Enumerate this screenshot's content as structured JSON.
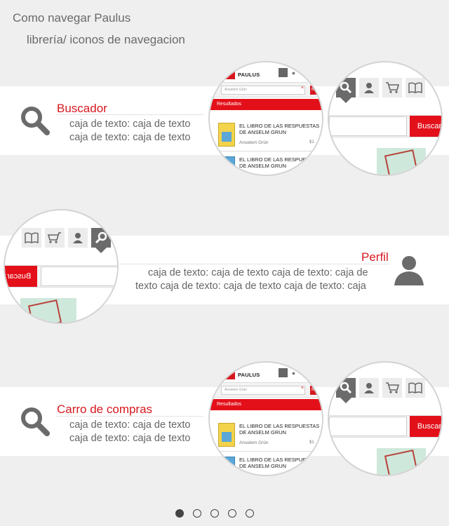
{
  "header": {
    "title": "Como navegar Paulus",
    "subtitle": "librería/ iconos de navegacion"
  },
  "sections": [
    {
      "title": "Buscador",
      "lines": [
        "caja de texto: caja de texto",
        "caja de texto: caja de texto"
      ],
      "icon": "search-icon"
    },
    {
      "title": "Perfil",
      "lines": [
        "caja de texto: caja de texto caja de texto: caja de",
        "texto caja de texto: caja de texto caja de texto: caja"
      ],
      "icon": "user-icon"
    },
    {
      "title": "Carro de compras",
      "lines": [
        "caja de texto: caja de texto",
        "caja de texto: caja de texto"
      ],
      "icon": "search-icon"
    }
  ],
  "preview": {
    "logo": "PAULUS",
    "search_value": "Anselem Grün",
    "search_button": "Buscar",
    "results_label": "Resultados",
    "books": [
      {
        "title_line1": "EL LIBRO DE LAS RESPUESTAS",
        "title_line2": "DE ANSELM GRUN",
        "author": "Anselem Grün",
        "price": "$1"
      },
      {
        "title_line1": "EL LIBRO DE LAS RESPUESTAS",
        "title_line2": "DE ANSELM GRUN",
        "author": "",
        "price": ""
      }
    ],
    "zoom_button": "Buscar",
    "zoom_button_mirrored": "Buscar"
  },
  "pagination": {
    "count": 5,
    "active": 0
  },
  "colors": {
    "accent": "#d6181f",
    "icon_grey": "#6b6b6b"
  }
}
